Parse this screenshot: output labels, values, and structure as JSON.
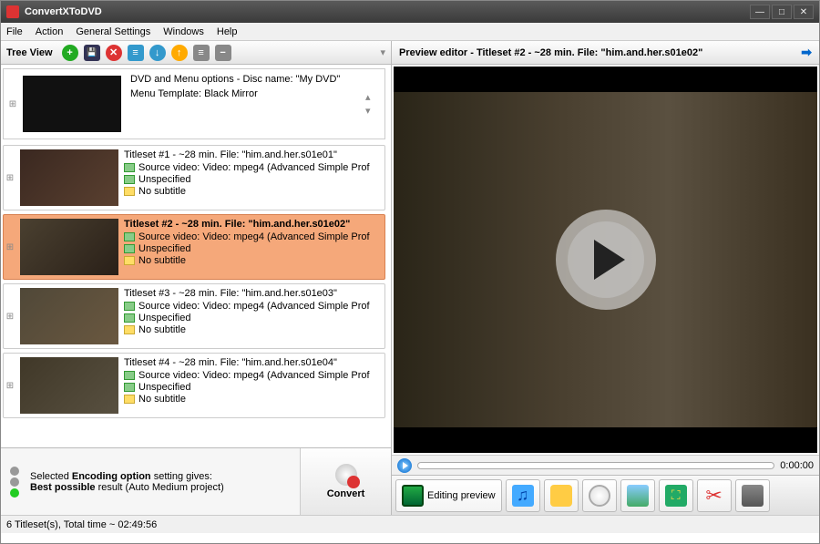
{
  "window": {
    "title": "ConvertXToDVD"
  },
  "menus": [
    "File",
    "Action",
    "General Settings",
    "Windows",
    "Help"
  ],
  "tree": {
    "label": "Tree View",
    "dvd": {
      "line1": "DVD and Menu options - Disc name: \"My DVD\"",
      "line2": "Menu Template: Black Mirror"
    },
    "items": [
      {
        "hdr": "Titleset #1 - ~28 min. File: \"him.and.her.s01e01\"",
        "src": "Source video: Video: mpeg4 (Advanced Simple Prof",
        "aud": "Unspecified",
        "sub": "No subtitle"
      },
      {
        "hdr": "Titleset #2 - ~28 min. File: \"him.and.her.s01e02\"",
        "src": "Source video: Video: mpeg4 (Advanced Simple Prof",
        "aud": "Unspecified",
        "sub": "No subtitle"
      },
      {
        "hdr": "Titleset #3 - ~28 min. File: \"him.and.her.s01e03\"",
        "src": "Source video: Video: mpeg4 (Advanced Simple Prof",
        "aud": "Unspecified",
        "sub": "No subtitle"
      },
      {
        "hdr": "Titleset #4 - ~28 min. File: \"him.and.her.s01e04\"",
        "src": "Source video: Video: mpeg4 (Advanced Simple Prof",
        "aud": "Unspecified",
        "sub": "No subtitle"
      }
    ]
  },
  "encoding": {
    "line1a": "Selected ",
    "line1b": "Encoding option",
    "line1c": " setting gives:",
    "line2a": "Best possible",
    "line2b": " result (Auto Medium project)"
  },
  "convert": "Convert",
  "preview": {
    "header": "Preview editor - Titleset #2 - ~28 min. File: \"him.and.her.s01e02\"",
    "time": "0:00:00"
  },
  "tabs": {
    "editing": "Editing preview"
  },
  "status": "6 Titleset(s), Total time ~ 02:49:56"
}
